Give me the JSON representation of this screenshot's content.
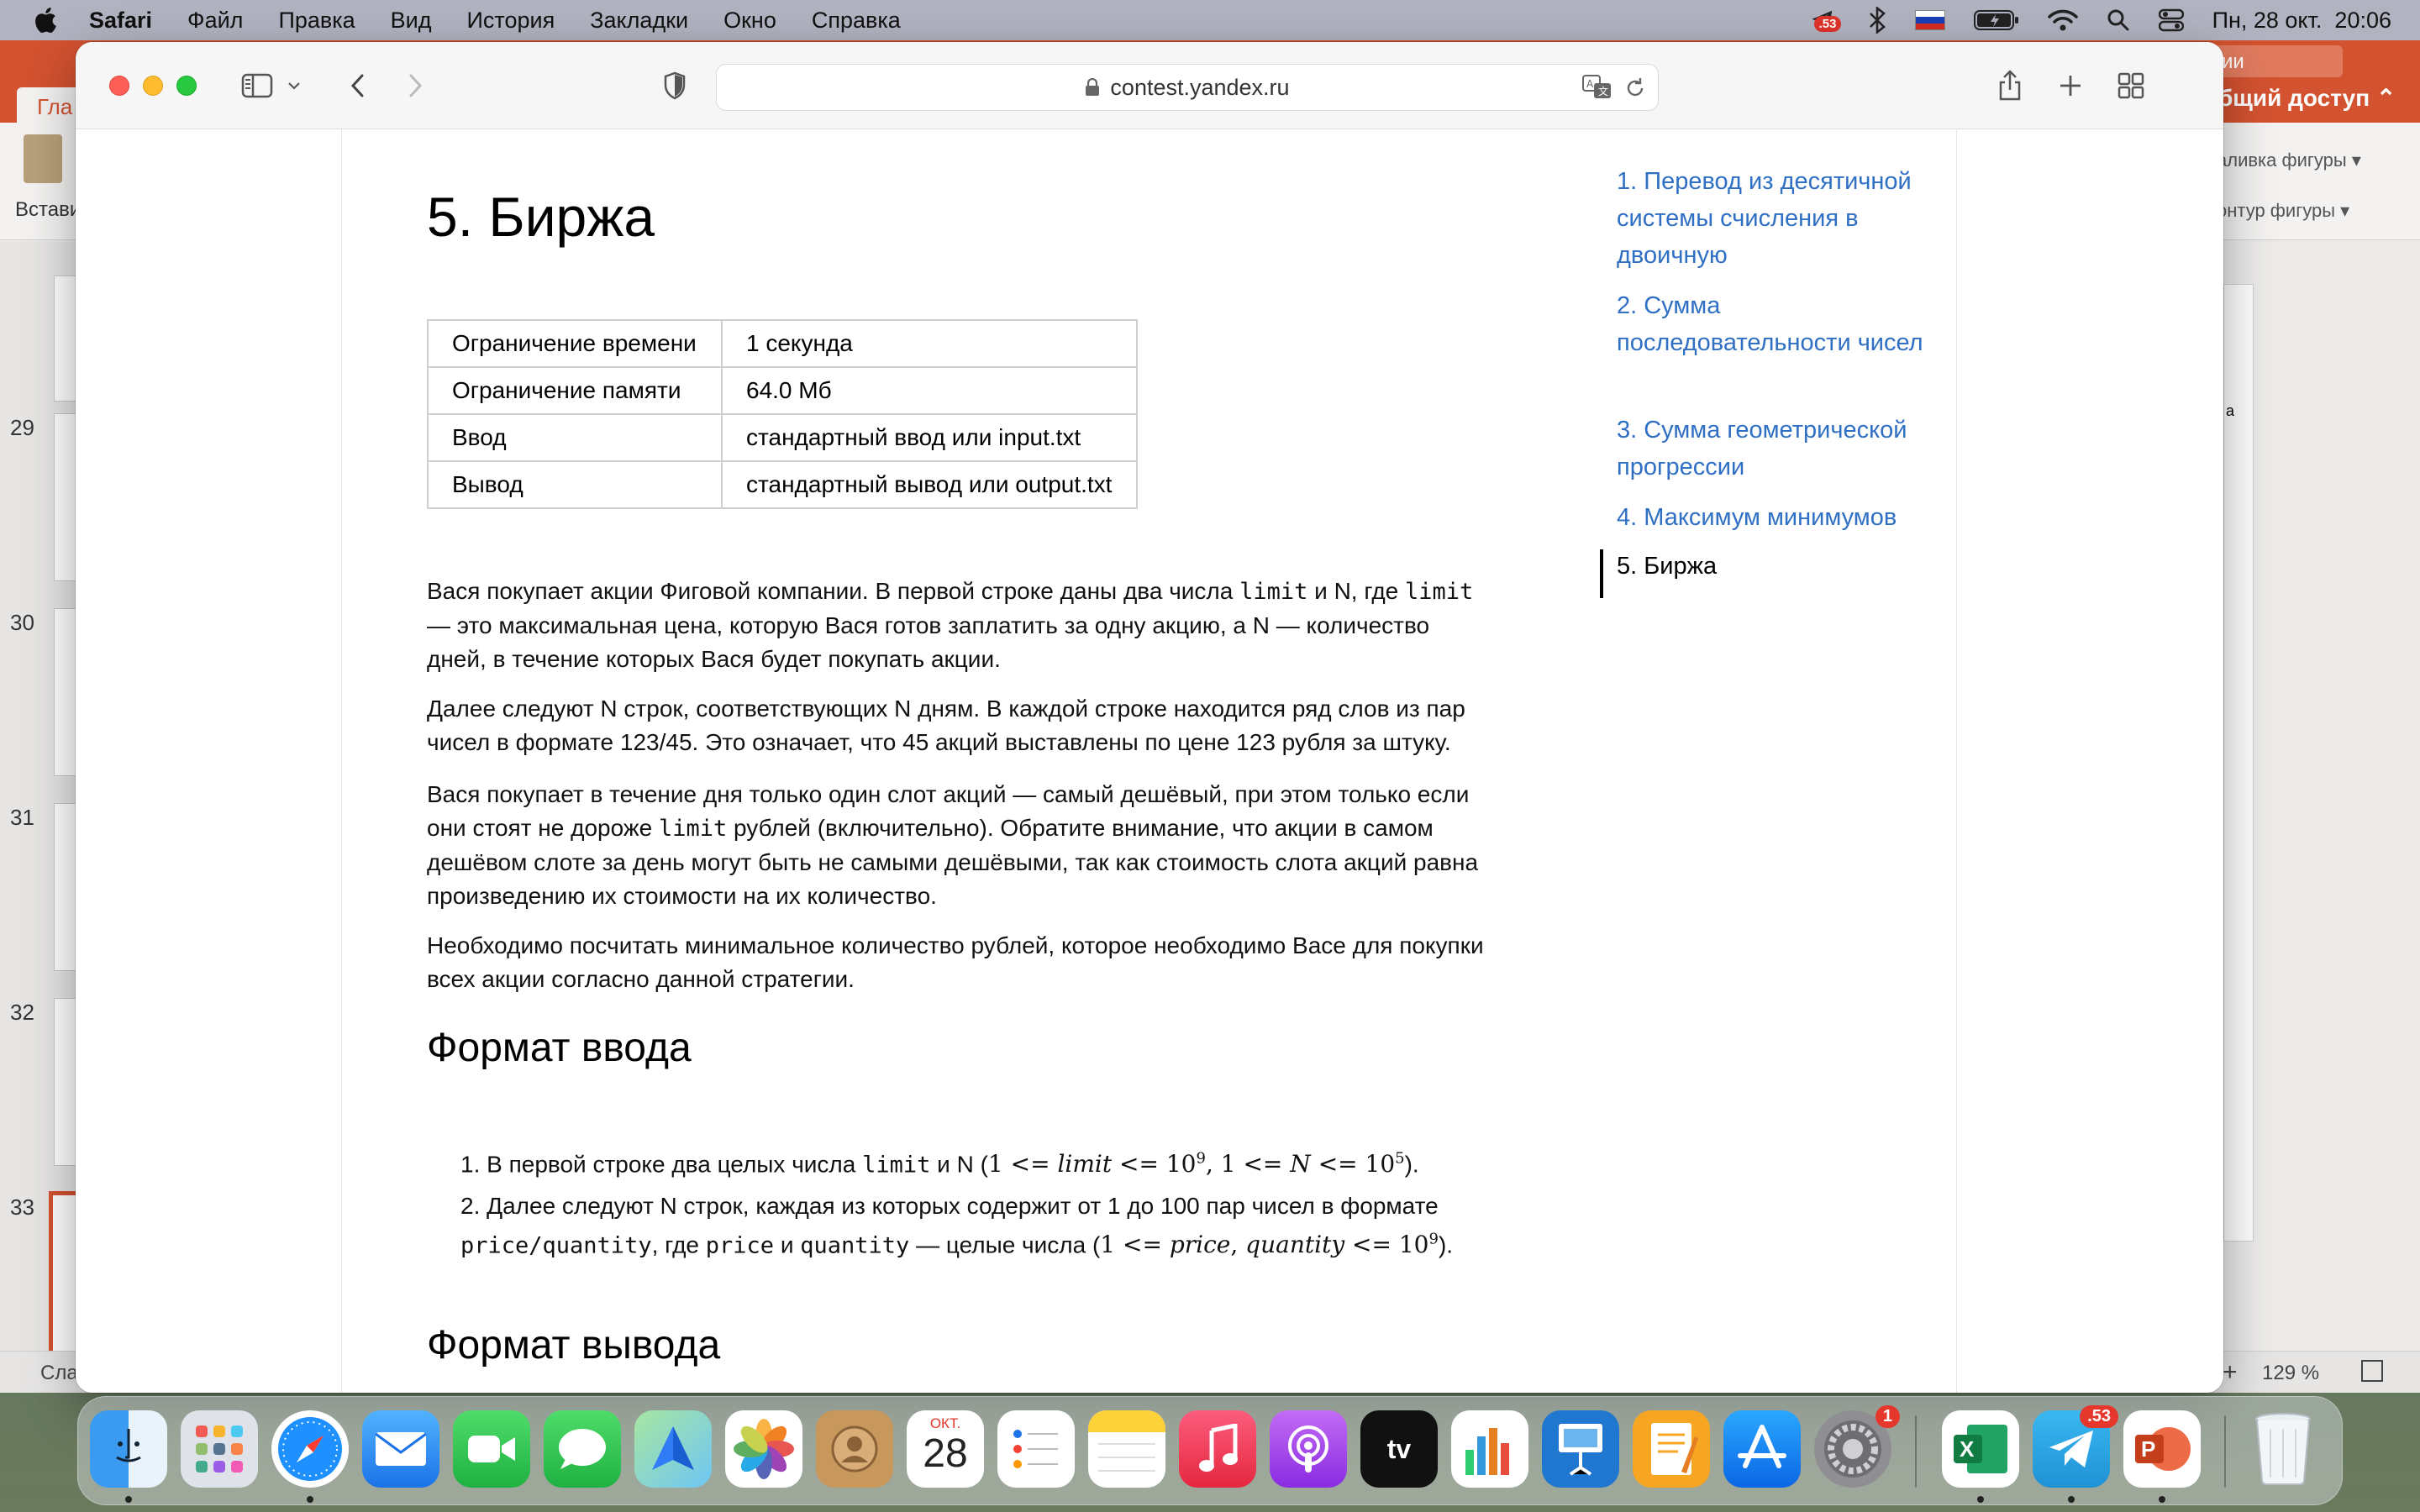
{
  "menubar": {
    "app_name": "Safari",
    "menus": [
      "Файл",
      "Правка",
      "Вид",
      "История",
      "Закладки",
      "Окно",
      "Справка"
    ],
    "telegram_badge": "53",
    "datetime": "Пн, 28 окт.  20:06"
  },
  "background_app": {
    "tab_label": "Гла",
    "search_text": "ии",
    "shared_access": "бщий доступ",
    "paste_label": "Вставить",
    "shape_fill": "аливка фигуры",
    "shape_outline": "онтур фигуры",
    "canvas_text": "a",
    "slide_numbers": [
      "29",
      "30",
      "31",
      "32",
      "33"
    ],
    "status_left": "Сла",
    "zoom": "129 %"
  },
  "browser": {
    "url": "contest.yandex.ru"
  },
  "problem": {
    "title": "5. Биржа",
    "limits": [
      {
        "key": "Ограничение времени",
        "value": "1 секунда"
      },
      {
        "key": "Ограничение памяти",
        "value": "64.0 Мб"
      },
      {
        "key": "Ввод",
        "value": "стандартный ввод или input.txt"
      },
      {
        "key": "Вывод",
        "value": "стандартный вывод или output.txt"
      }
    ],
    "statement": {
      "p1_a": "Вася покупает акции Фиговой компании. В первой строке даны два числа ",
      "code_limit": "limit",
      "p1_b": " и N, где ",
      "p1_c": " — это максимальная цена, которую Вася готов заплатить за одну акцию, а N — количество дней, в течение которых Вася будет покупать акции.",
      "p2": "Далее следуют N строк, соответствующих N дням. В каждой строке находится ряд слов из пар чисел в формате 123/45. Это означает, что 45 акций выставлены по цене 123 рубля за штуку.",
      "p3_a": "Вася покупает в течение дня только один слот акций — самый дешёвый, при этом только если они стоят не дороже ",
      "p3_b": " рублей (включительно). Обратите внимание, что акции в самом дешёвом слоте за день могут быть не самыми дешёвыми, так как стоимость слота акций равна произведению их стоимости на их количество.",
      "p4": "Необходимо посчитать минимальное количество рублей, которое необходимо Васе для покупки всех акции согласно данной стратегии."
    },
    "input_format": {
      "heading": "Формат ввода",
      "item1_a": "1. В первой строке два целых числа ",
      "item1_b": " и N (",
      "item1_c": ").",
      "item2_a": "2. Далее следуют N строк, каждая из которых содержит от 1 до 100 пар чисел в формате ",
      "code_pq": "price/quantity",
      "item2_b": ", где ",
      "code_price": "price",
      "item2_c": " и ",
      "code_quantity": "quantity",
      "item2_d": " — целые числа (",
      "item2_e": ")."
    },
    "output_format": {
      "heading": "Формат вывода"
    }
  },
  "toc": {
    "items": [
      "1. Перевод из десятичной системы счисления в двоичную",
      "2. Сумма последовательности чисел",
      "3. Сумма геометрической прогрессии",
      "4. Максимум минимумов",
      "5. Биржа"
    ],
    "active_index": 4
  },
  "dock": {
    "calendar_month": "ОКТ.",
    "calendar_day": "28",
    "settings_badge": "1",
    "telegram_badge": "53"
  }
}
